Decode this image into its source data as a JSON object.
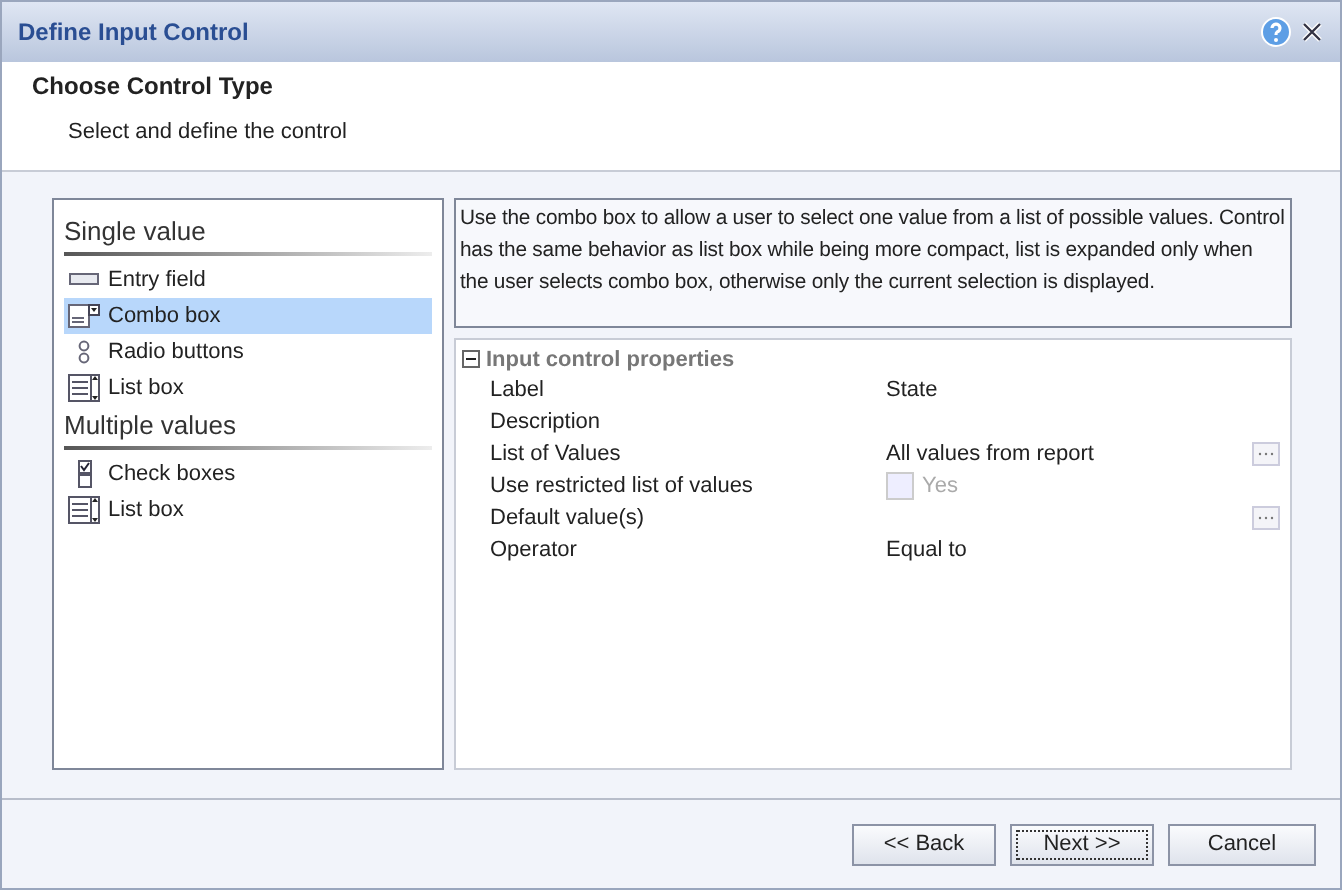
{
  "window": {
    "title": "Define Input Control"
  },
  "header": {
    "title": "Choose Control Type",
    "subtitle": "Select and define the control"
  },
  "control_groups": [
    {
      "heading": "Single value",
      "items": [
        {
          "label": "Entry field",
          "kind": "entry",
          "selected": false
        },
        {
          "label": "Combo box",
          "kind": "combo",
          "selected": true
        },
        {
          "label": "Radio buttons",
          "kind": "radio",
          "selected": false
        },
        {
          "label": "List box",
          "kind": "list",
          "selected": false
        }
      ]
    },
    {
      "heading": "Multiple values",
      "items": [
        {
          "label": "Check boxes",
          "kind": "check",
          "selected": false
        },
        {
          "label": "List box",
          "kind": "list",
          "selected": false
        }
      ]
    }
  ],
  "description": "Use the combo box to allow a user to select one value from a list of possible values. Control has the same behavior as list box while being more compact, list is expanded only when the user selects combo box, otherwise only the current selection is displayed.",
  "properties": {
    "title": "Input control properties",
    "expanded": true,
    "rows": [
      {
        "name": "Label",
        "value": "State",
        "kind": "text"
      },
      {
        "name": "Description",
        "kind": "text"
      },
      {
        "name": "List of Values",
        "value": "All values from report",
        "kind": "picker"
      },
      {
        "name": "Use restricted list of values",
        "value": "Yes",
        "kind": "checkbox",
        "checked": false,
        "disabled": true
      },
      {
        "name": "Default value(s)",
        "kind": "picker"
      },
      {
        "name": "Operator",
        "value": "Equal to",
        "kind": "text"
      }
    ]
  },
  "buttons": [
    {
      "label": "<< Back",
      "focused": false
    },
    {
      "label": "Next >>",
      "focused": true
    },
    {
      "label": "Cancel",
      "focused": false
    }
  ]
}
